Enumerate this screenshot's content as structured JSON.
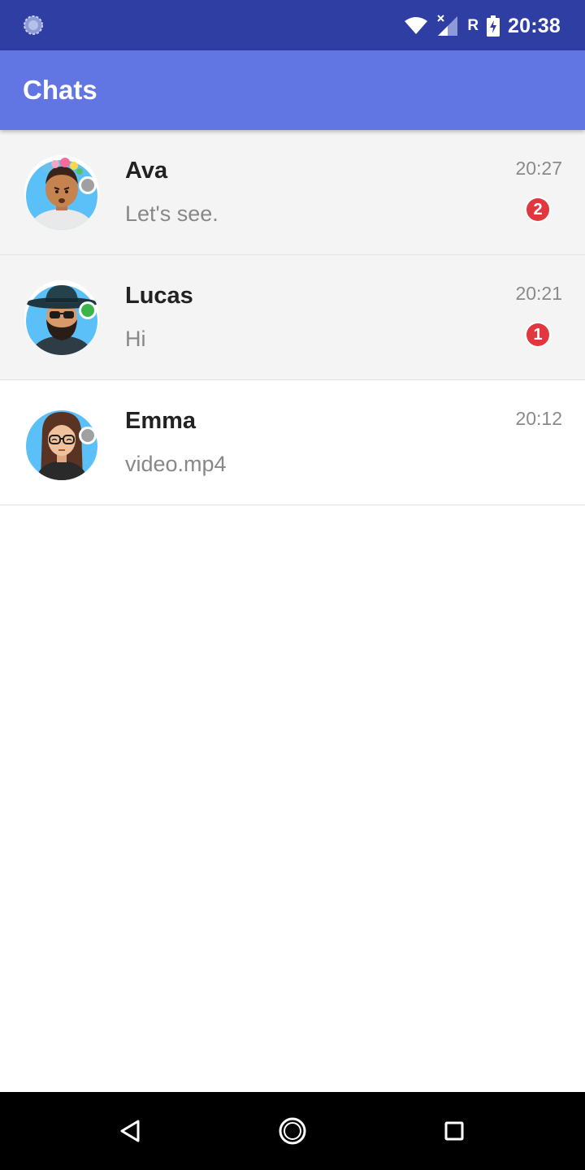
{
  "status_bar": {
    "time": "20:38",
    "roaming_label": "R",
    "icons": [
      "loading-icon",
      "wifi-icon",
      "signal-icon",
      "battery-charging-icon"
    ]
  },
  "app_bar": {
    "title": "Chats"
  },
  "colors": {
    "status_bar": "#2f3ea3",
    "app_bar": "#6175e3",
    "badge": "#e0383e",
    "online": "#3bb54a",
    "offline": "#a0a0a0",
    "avatar_bg": "#5bc0f8"
  },
  "chats": [
    {
      "name": "Ava",
      "preview": "Let's see.",
      "time": "20:27",
      "unread": "2",
      "presence": "offline",
      "avatar_icon": "avatar-ava-icon"
    },
    {
      "name": "Lucas",
      "preview": "Hi",
      "time": "20:21",
      "unread": "1",
      "presence": "online",
      "avatar_icon": "avatar-lucas-icon"
    },
    {
      "name": "Emma",
      "preview": "video.mp4",
      "time": "20:12",
      "unread": "",
      "presence": "offline",
      "avatar_icon": "avatar-emma-icon"
    }
  ],
  "nav_bar": {
    "icons": [
      "back-icon",
      "home-icon",
      "recents-icon"
    ]
  }
}
